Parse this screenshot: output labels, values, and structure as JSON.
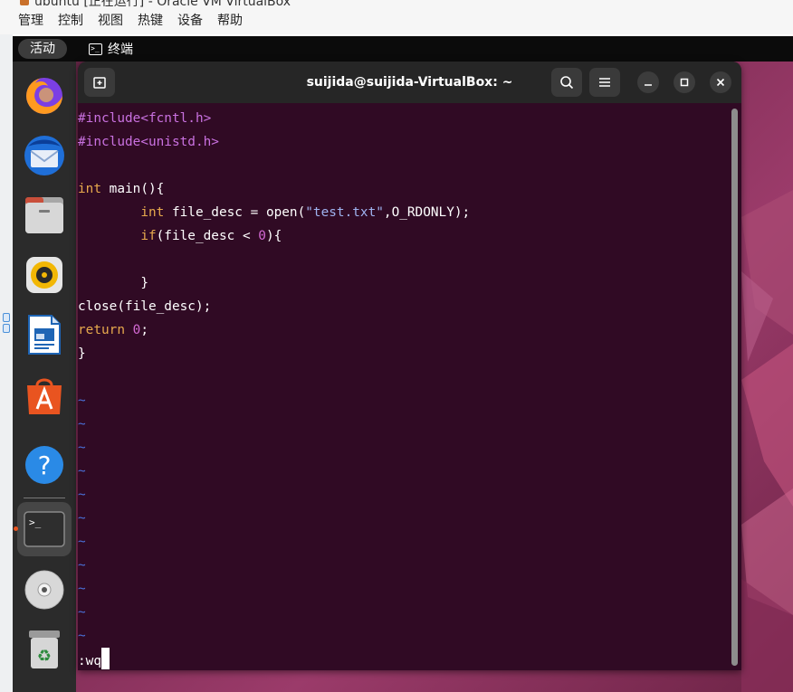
{
  "host": {
    "title": "ubuntu [正在运行] - Oracle VM VirtualBox",
    "menu": [
      "管理",
      "控制",
      "视图",
      "热键",
      "设备",
      "帮助"
    ]
  },
  "topbar": {
    "activities": "活动",
    "app_name": "终端",
    "app_icon": "terminal-icon"
  },
  "dock": {
    "items": [
      {
        "name": "firefox",
        "icon": "firefox-icon",
        "active": false
      },
      {
        "name": "thunderbird",
        "icon": "thunderbird-icon",
        "active": false
      },
      {
        "name": "files",
        "icon": "files-icon",
        "active": false
      },
      {
        "name": "rhythmbox",
        "icon": "rhythmbox-icon",
        "active": false
      },
      {
        "name": "writer",
        "icon": "libreoffice-writer-icon",
        "active": false
      },
      {
        "name": "software",
        "icon": "app-center-icon",
        "active": false
      },
      {
        "name": "help",
        "icon": "help-icon",
        "active": false
      },
      {
        "name": "terminal",
        "icon": "terminal-icon",
        "active": true
      },
      {
        "name": "disc",
        "icon": "dvd-icon",
        "active": false
      },
      {
        "name": "trash",
        "icon": "trash-icon",
        "active": false
      }
    ]
  },
  "terminal": {
    "title": "suijida@suijida-VirtualBox: ~",
    "tab_icon": "new-tab-icon",
    "command_line": ":wq",
    "colors": {
      "background": "#300a24",
      "keyword": "#e7a94d",
      "preprocessor": "#c971e0",
      "string": "#9fb3f0",
      "number": "#d46ad4",
      "tilde": "#4a6fd6"
    },
    "code": {
      "l1_a": "#include",
      "l1_b": "<fcntl.h>",
      "l2_a": "#include",
      "l2_b": "<unistd.h>",
      "l4_a": "int",
      "l4_b": " main(){",
      "l5_indent": "        ",
      "l5_a": "int",
      "l5_b": " file_desc = open(",
      "l5_c": "\"test.txt\"",
      "l5_d": ",O_RDONLY);",
      "l6_a": "if",
      "l6_b": "(file_desc < ",
      "l6_c": "0",
      "l6_d": "){",
      "l8_a": "}",
      "l9_a": "close(file_desc);",
      "l10_a": "return",
      "l10_b": " ",
      "l10_c": "0",
      "l10_d": ";",
      "l11_a": "}"
    },
    "tilde": "~"
  }
}
